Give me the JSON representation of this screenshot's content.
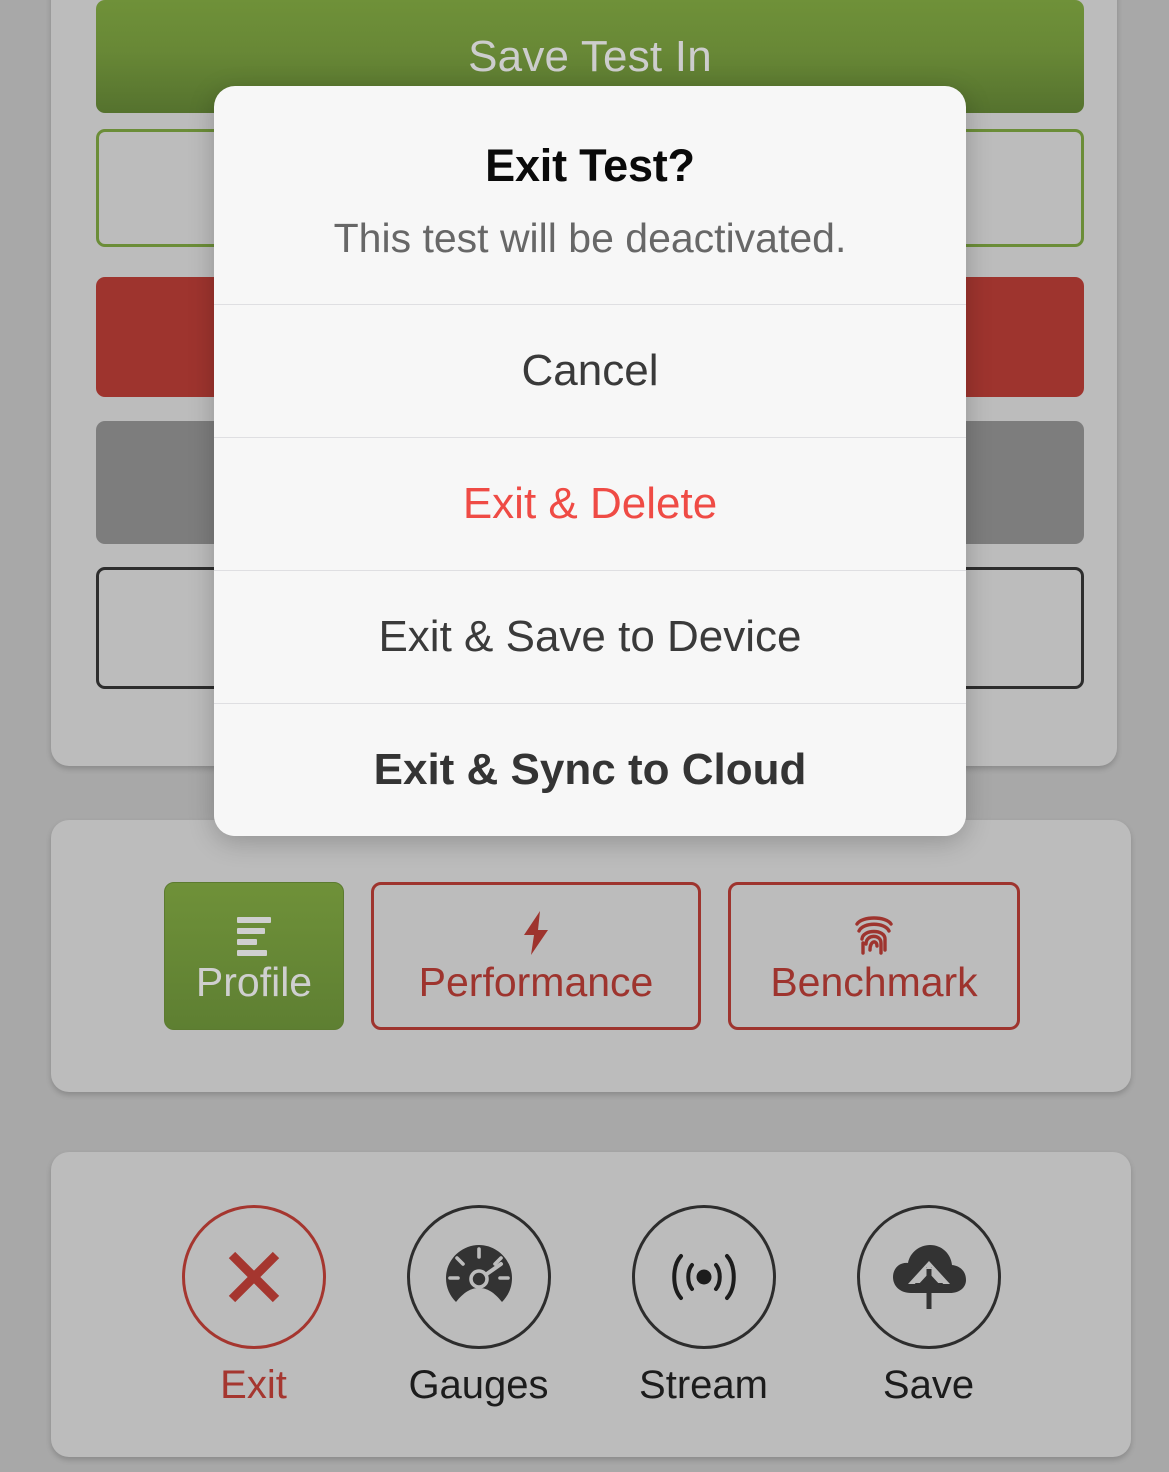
{
  "app": {
    "save_panel": {
      "banner_label": "Save Test In",
      "rows": [
        {
          "name": "green-outline-row"
        },
        {
          "name": "red-filled-row"
        },
        {
          "name": "gray-filled-row"
        },
        {
          "name": "dark-outline-row"
        }
      ]
    },
    "mode_selector": {
      "options": [
        {
          "label": "Profile",
          "icon": "list-icon",
          "state": "active"
        },
        {
          "label": "Performance",
          "icon": "lightning-icon",
          "state": "inactive"
        },
        {
          "label": "Benchmark",
          "icon": "fingerprint-icon",
          "state": "inactive"
        }
      ]
    },
    "toolbar": {
      "items": [
        {
          "label": "Exit",
          "icon": "close-x-icon",
          "accent": "#a5362f"
        },
        {
          "label": "Gauges",
          "icon": "gauge-icon",
          "accent": "#2d2d2d"
        },
        {
          "label": "Stream",
          "icon": "broadcast-icon",
          "accent": "#2d2d2d"
        },
        {
          "label": "Save",
          "icon": "cloud-upload-icon",
          "accent": "#2d2d2d"
        }
      ]
    }
  },
  "dialog": {
    "title": "Exit Test?",
    "message": "This test will be deactivated.",
    "actions": [
      {
        "label": "Cancel",
        "style": "neutral"
      },
      {
        "label": "Exit & Delete",
        "style": "destructive"
      },
      {
        "label": "Exit & Save to Device",
        "style": "neutral"
      },
      {
        "label": "Exit & Sync to Cloud",
        "style": "preferred"
      }
    ]
  },
  "colors": {
    "brand_green": "#6b8d38",
    "brand_red": "#9e342e",
    "destructive_red": "#ef4b45",
    "panel_gray": "#bcbcbc",
    "backdrop_gray": "#a8a8a8",
    "dialog_bg": "#f7f7f7"
  }
}
